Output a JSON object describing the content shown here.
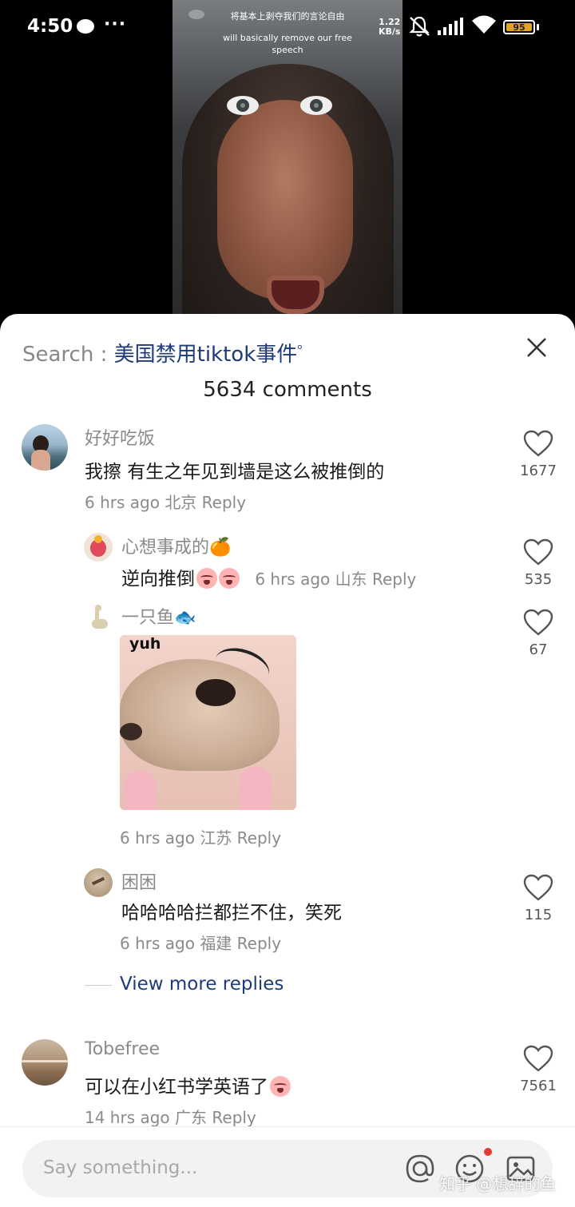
{
  "status_bar": {
    "time": "4:50",
    "net_speed_value": "1.22",
    "net_speed_unit": "KB/s",
    "battery": "95"
  },
  "video": {
    "subtitle_zh": "将基本上剥夺我们的言论自由",
    "subtitle_en": "will basically remove our free speech"
  },
  "sheet": {
    "search_prefix": "Search : ",
    "search_term": "美国禁用tiktok事件",
    "comment_count": "5634 comments",
    "close_icon": "close-icon"
  },
  "comments": [
    {
      "username": "好好吃饭",
      "text": "我擦 有生之年见到墙是这么被推倒的",
      "time": "6 hrs ago",
      "location": "北京",
      "reply": "Reply",
      "likes": "1677"
    },
    {
      "username": "心想事成的",
      "username_emoji": "🍊",
      "text": "逆向推倒",
      "time": "6 hrs ago",
      "location": "山东",
      "reply": "Reply",
      "likes": "535"
    },
    {
      "username": "一只鱼",
      "username_emoji": "🐟",
      "sticker_text": "yuh",
      "time": "6 hrs ago",
      "location": "江苏",
      "reply": "Reply",
      "likes": "67"
    },
    {
      "username": "困困",
      "text": "哈哈哈哈拦都拦不住，笑死",
      "time": "6 hrs ago",
      "location": "福建",
      "reply": "Reply",
      "likes": "115"
    },
    {
      "username": "Tobefree",
      "text": "可以在小红书学英语了",
      "time": "14 hrs ago",
      "location": "广东",
      "reply": "Reply",
      "likes": "7561"
    }
  ],
  "view_more": "View more replies",
  "input": {
    "placeholder": "Say something..."
  },
  "watermark": "知乎 @想辞的鱼",
  "colors": {
    "link": "#1e3a78",
    "muted": "#8a8a8a",
    "notif_dot": "#e53935",
    "battery": "#e0a323"
  }
}
